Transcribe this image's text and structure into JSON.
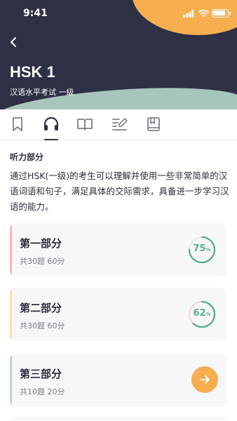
{
  "status": {
    "time": "9:41"
  },
  "header": {
    "title": "HSK 1",
    "subtitle": "汉语水平考试 一级"
  },
  "tabs": [
    {
      "icon": "bookmark-icon",
      "active": false
    },
    {
      "icon": "headphones-icon",
      "active": true
    },
    {
      "icon": "open-book-icon",
      "active": false
    },
    {
      "icon": "writing-icon",
      "active": false
    },
    {
      "icon": "notebook-icon",
      "active": false
    }
  ],
  "section": {
    "title": "听力部分",
    "description": "通过HSK(一级)的考生可以理解并使用一些非常简单的汉语词语和句子，满足具体的交际需求，具备进一步学习汉语的能力。"
  },
  "parts": [
    {
      "title": "第一部分",
      "meta": "共30题 60分",
      "progress": 75,
      "progress_label": "75",
      "unit": "%",
      "accent": "#f7b4b4",
      "ring": "#5aaf96"
    },
    {
      "title": "第二部分",
      "meta": "共30题 60分",
      "progress": 62,
      "progress_label": "62",
      "unit": "%",
      "accent": "#fadfae",
      "ring": "#5aaf96"
    },
    {
      "title": "第三部分",
      "meta": "共10题 20分",
      "accent": "#bcd8cd",
      "action_icon": "arrow-right-icon"
    }
  ],
  "colors": {
    "hero": "#2e3045",
    "orange": "#f6ae4f",
    "teal": "#5aaf96",
    "track": "#f3d3d3"
  }
}
